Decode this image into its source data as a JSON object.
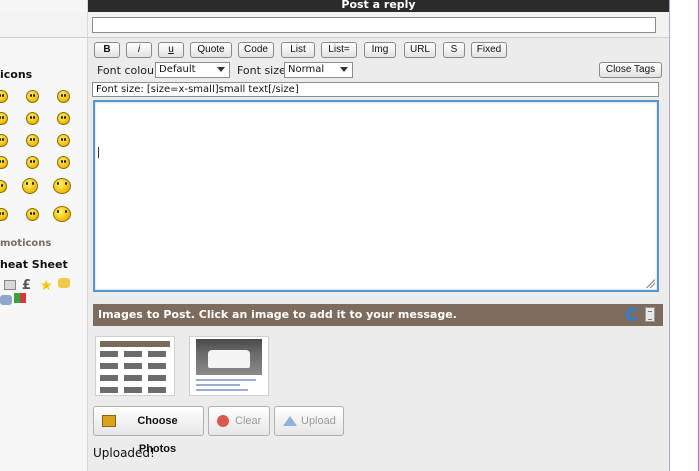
{
  "header": {
    "title": "Post a reply"
  },
  "toolbar": {
    "buttons": [
      {
        "label": "B",
        "style": "bold"
      },
      {
        "label": "i",
        "style": "italic"
      },
      {
        "label": "u",
        "style": "underline"
      },
      {
        "label": "Quote"
      },
      {
        "label": "Code"
      },
      {
        "label": "List"
      },
      {
        "label": "List="
      },
      {
        "label": "Img"
      },
      {
        "label": "URL"
      },
      {
        "label": "S"
      },
      {
        "label": "Fixed"
      }
    ],
    "font_colour_label": "Font colour",
    "font_colour_value": "Default",
    "font_size_label": "Font size",
    "font_size_value": "Normal",
    "close_tags_label": "Close Tags",
    "help_text": "Font size: [size=x-small]small text[/size]"
  },
  "subject": {
    "value": ""
  },
  "message": {
    "value": ""
  },
  "images": {
    "bar_text": "Images to Post. Click an image to add it to your message.",
    "thumbnails": [
      {
        "name": "screenshot thumbnail"
      },
      {
        "name": "car photo thumbnail"
      }
    ]
  },
  "actions": {
    "choose_photos": "Choose Photos",
    "clear": "Clear",
    "upload": "Upload",
    "status": "Uploaded!"
  },
  "left_column": {
    "emoticons_title": "icons",
    "more_emoticons": "moticons",
    "cheat_sheet": "heat Sheet"
  },
  "colors": {
    "header_bg": "#2b2b2b",
    "images_bar_bg": "#7d6b5d",
    "textarea_border": "#5b95c8",
    "left_link": "#7b6b62"
  }
}
